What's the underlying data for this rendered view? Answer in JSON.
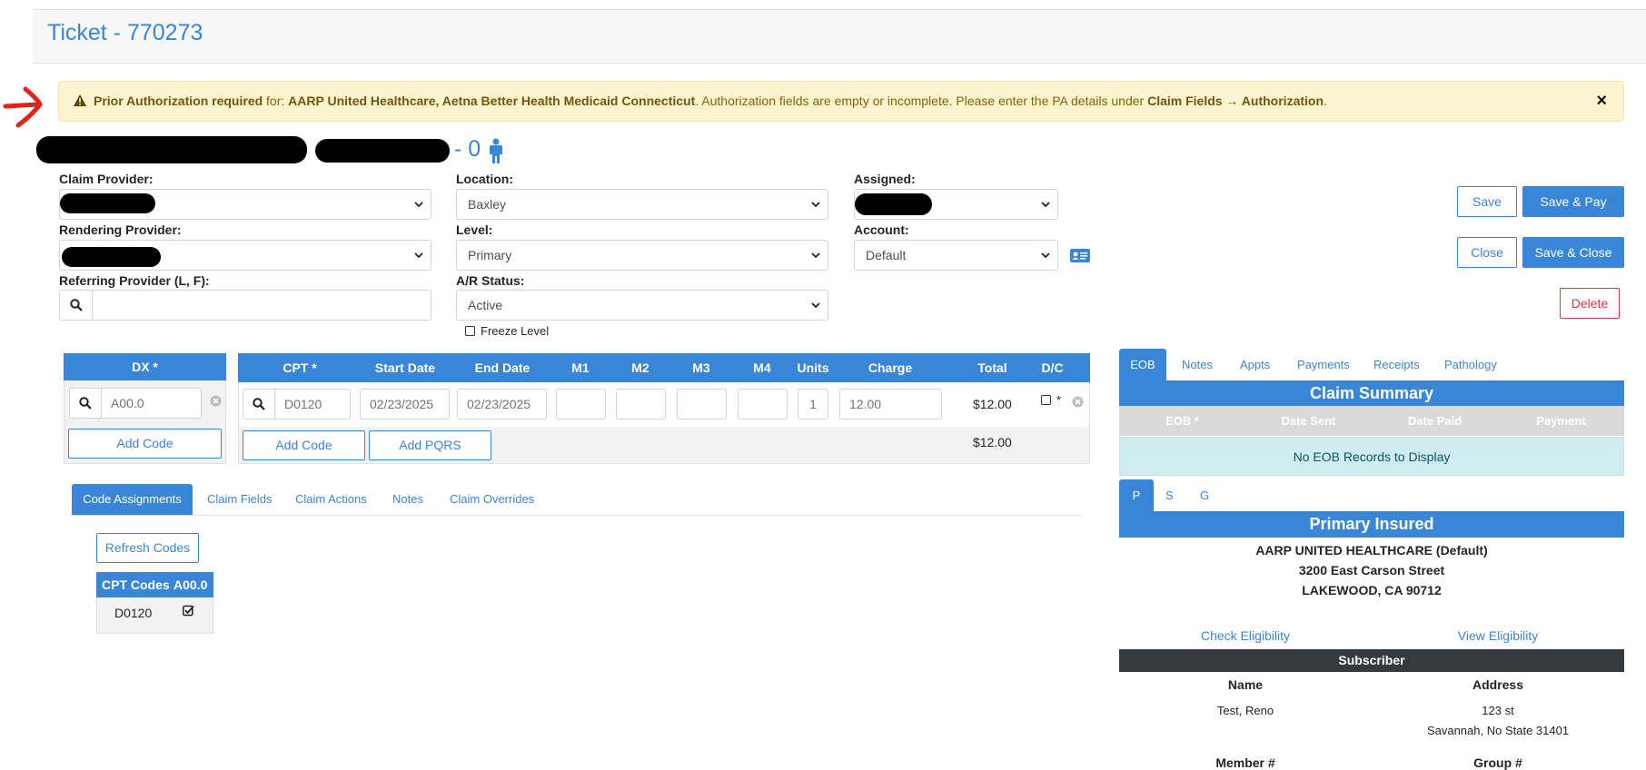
{
  "header": {
    "title": "Ticket - 770273"
  },
  "alert": {
    "icon": "warning-triangle-icon",
    "strong1": "Prior Authorization required",
    "text1": " for: ",
    "payers": "AARP United Healthcare, Aetna Better Health Medicaid Connecticut",
    "text2": ". Authorization fields are empty or incomplete. Please enter the PA details under ",
    "path": "Claim Fields → Authorization",
    "text3": ".",
    "close": "×"
  },
  "patient": {
    "suffix": "- 0"
  },
  "form": {
    "claim_provider_label": "Claim Provider:",
    "rendering_provider_label": "Rendering Provider:",
    "referring_provider_label": "Referring Provider (L, F):",
    "referring_provider_value": "",
    "location_label": "Location:",
    "location_value": "Baxley",
    "level_label": "Level:",
    "level_value": "Primary",
    "ar_status_label": "A/R Status:",
    "ar_status_value": "Active",
    "freeze_level_label": "Freeze Level",
    "assigned_label": "Assigned:",
    "account_label": "Account:",
    "account_value": "Default"
  },
  "actions": {
    "save": "Save",
    "save_pay": "Save & Pay",
    "close": "Close",
    "save_close": "Save & Close",
    "delete": "Delete"
  },
  "dx": {
    "header": "DX *",
    "code": "A00.0",
    "add_code": "Add Code"
  },
  "cpt": {
    "headers": [
      "CPT *",
      "Start Date",
      "End Date",
      "M1",
      "M2",
      "M3",
      "M4",
      "Units",
      "Charge",
      "Total",
      "D/C"
    ],
    "row": {
      "cpt": "D0120",
      "start": "02/23/2025",
      "end": "02/23/2025",
      "m1": "",
      "m2": "",
      "m3": "",
      "m4": "",
      "units": "1",
      "charge": "12.00",
      "total": "$12.00",
      "dc_mark": "*"
    },
    "add_code": "Add Code",
    "add_pqrs": "Add PQRS",
    "grand_total": "$12.00"
  },
  "bottom_tabs": [
    "Code Assignments",
    "Claim Fields",
    "Claim Actions",
    "Notes",
    "Claim Overrides"
  ],
  "code_assign": {
    "refresh": "Refresh Codes",
    "col1": "CPT Codes",
    "col2": "A00.0",
    "row_code": "D0120"
  },
  "right_tabs": [
    "EOB",
    "Notes",
    "Appts",
    "Payments",
    "Receipts",
    "Pathology"
  ],
  "claim_summary": {
    "title": "Claim Summary",
    "cols": [
      "EOB *",
      "Date Sent",
      "Date Paid",
      "Payment"
    ],
    "empty": "No EOB Records to Display"
  },
  "insured_tabs": [
    "P",
    "S",
    "G"
  ],
  "insured": {
    "title": "Primary Insured",
    "line1": "AARP UNITED HEALTHCARE (Default)",
    "line2": "3200 East Carson Street",
    "line3": "LAKEWOOD, CA 90712",
    "check": "Check Eligibility",
    "view": "View Eligibility"
  },
  "subscriber": {
    "title": "Subscriber",
    "name_label": "Name",
    "address_label": "Address",
    "name": "Test, Reno",
    "address1": "123 st",
    "address2": "Savannah, No State 31401",
    "member_label": "Member #",
    "group_label": "Group #"
  },
  "colors": {
    "primary": "#3a86d6",
    "danger": "#dc3545",
    "alert_bg": "#fcf3cf",
    "dark": "#343a40"
  }
}
